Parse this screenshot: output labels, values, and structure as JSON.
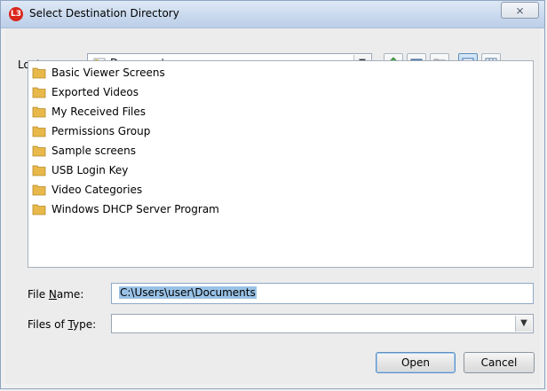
{
  "window": {
    "title": "Select Destination Directory",
    "app_icon_text": "L3",
    "close_glyph": "⨯"
  },
  "look_in": {
    "label_prefix": "Look ",
    "label_mnemonic": "I",
    "label_suffix": "n:",
    "value": "Documents"
  },
  "toolbar": {
    "buttons": [
      "up-one-level-icon",
      "new-folder-icon",
      "home-folder-icon",
      "list-view-icon",
      "details-view-icon"
    ]
  },
  "files": [
    "Basic Viewer Screens",
    "Exported Videos",
    "My Received Files",
    "Permissions Group",
    "Sample screens",
    "USB Login Key",
    "Video Categories",
    "Windows DHCP Server Program"
  ],
  "file_name": {
    "label_prefix": "File ",
    "label_mnemonic": "N",
    "label_suffix": "ame:",
    "value": "C:\\Users\\user\\Documents"
  },
  "file_type": {
    "label_prefix": "Files of ",
    "label_mnemonic": "T",
    "label_suffix": "ype:",
    "value": ""
  },
  "buttons": {
    "open": "Open",
    "cancel": "Cancel"
  },
  "colors": {
    "accent_icon": "#d9261c",
    "selection": "#99c2e6",
    "folder": "#e8b94a"
  }
}
